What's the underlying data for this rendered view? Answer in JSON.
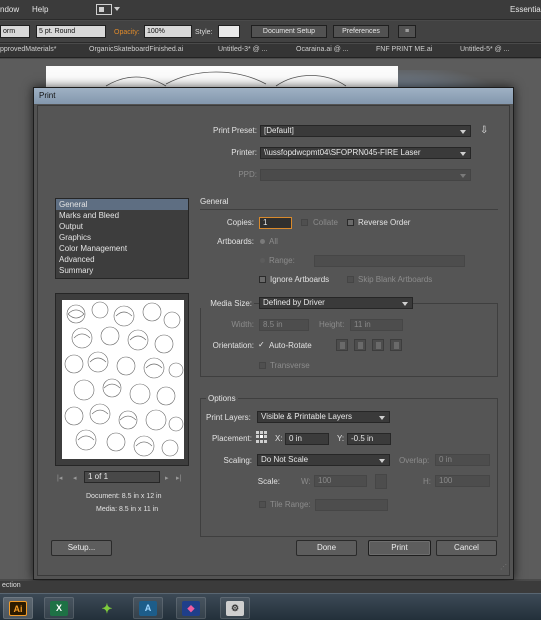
{
  "menu": {
    "window": "ndow",
    "help": "Help",
    "workspace": "Essentia"
  },
  "control_bar": {
    "transform": "orm",
    "stroke_profile": "5 pt. Round",
    "opacity_label": "Opacity:",
    "opacity_value": "100%",
    "style_label": "Style:",
    "document_setup": "Document Setup",
    "preferences": "Preferences"
  },
  "tabs": [
    "pprovedMaterials*",
    "OrganicSkateboardFinished.ai",
    "Untitled-3* @ ...",
    "Ocaraina.ai @ ...",
    "FNF PRINT ME.ai",
    "Untitled-5* @ ..."
  ],
  "dialog": {
    "title": "Print",
    "print_preset_label": "Print Preset:",
    "print_preset_value": "[Default]",
    "printer_label": "Printer:",
    "printer_value": "\\\\ussfopdwcpmt04\\SFOPRN045-FIRE Laser",
    "ppd_label": "PPD:",
    "categories": [
      "General",
      "Marks and Bleed",
      "Output",
      "Graphics",
      "Color Management",
      "Advanced",
      "Summary"
    ],
    "selected_category": "General",
    "general_header": "General",
    "copies_label": "Copies:",
    "copies_value": "1",
    "collate": "Collate",
    "reverse_order": "Reverse Order",
    "artboards_label": "Artboards:",
    "all": "All",
    "range": "Range:",
    "ignore_artboards": "Ignore Artboards",
    "skip_blank": "Skip Blank Artboards",
    "media_size_label": "Media Size:",
    "media_size_value": "Defined by Driver",
    "width_label": "Width:",
    "width_value": "8.5 in",
    "height_label": "Height:",
    "height_value": "11 in",
    "orientation_label": "Orientation:",
    "auto_rotate": "Auto-Rotate",
    "transverse": "Transverse",
    "options_header": "Options",
    "print_layers_label": "Print Layers:",
    "print_layers_value": "Visible & Printable Layers",
    "placement_label": "Placement:",
    "x_label": "X:",
    "x_value": "0 in",
    "y_label": "Y:",
    "y_value": "-0.5 in",
    "scaling_label": "Scaling:",
    "scaling_value": "Do Not Scale",
    "overlap_label": "Overlap:",
    "overlap_value": "0 in",
    "scale_label": "Scale:",
    "w_label": "W:",
    "w_value": "100",
    "h_label": "H:",
    "h_value": "100",
    "tile_range": "Tile Range:",
    "page_indicator": "1 of 1",
    "document_size": "Document: 8.5 in x 12 in",
    "media_size_info": "Media: 8.5 in x 11 in",
    "setup_button": "Setup...",
    "done_button": "Done",
    "print_button": "Print",
    "cancel_button": "Cancel"
  },
  "status": {
    "selection": "ection"
  },
  "taskbar": {
    "illustrator": "Ai"
  }
}
